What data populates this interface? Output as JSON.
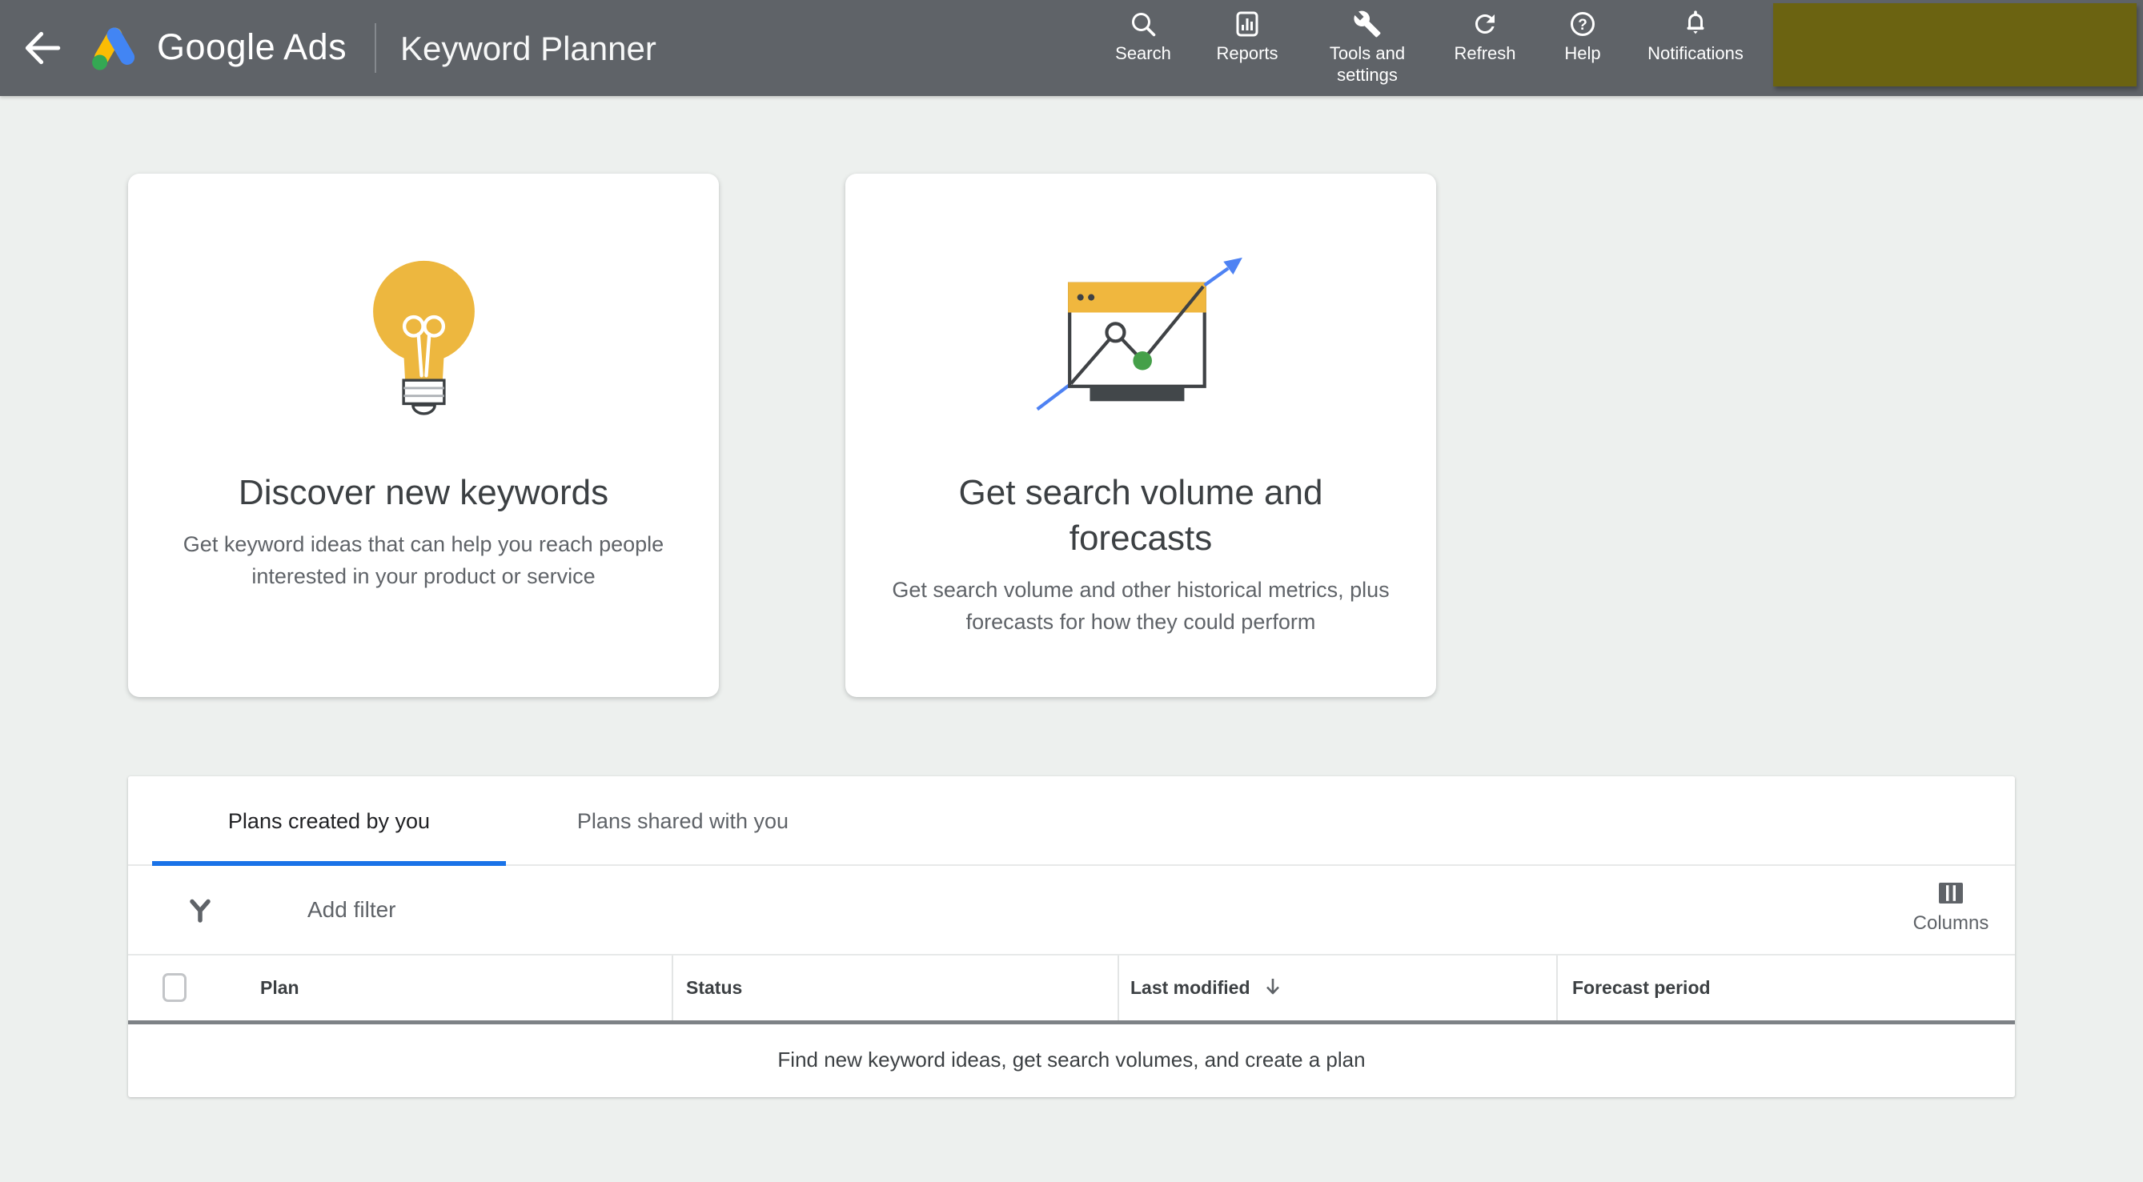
{
  "topbar": {
    "brand": {
      "word1": "Google",
      "word2": "Ads"
    },
    "page_title": "Keyword Planner",
    "nav": [
      {
        "icon": "search-icon",
        "label": "Search"
      },
      {
        "icon": "reports-icon",
        "label": "Reports"
      },
      {
        "icon": "wrench-icon",
        "label": "Tools and settings"
      },
      {
        "icon": "refresh-icon",
        "label": "Refresh"
      },
      {
        "icon": "help-icon",
        "label": "Help"
      },
      {
        "icon": "bell-icon",
        "label": "Notifications"
      }
    ],
    "help_glyph": "?"
  },
  "cards": [
    {
      "icon": "lightbulb-icon",
      "title": "Discover new keywords",
      "subtitle": "Get keyword ideas that can help you reach people interested in your product or service"
    },
    {
      "icon": "chart-window-icon",
      "title": "Get search volume and forecasts",
      "subtitle": "Get search volume and other historical metrics, plus forecasts for how they could perform"
    }
  ],
  "plans_panel": {
    "tabs": [
      {
        "label": "Plans created by you",
        "active": true
      },
      {
        "label": "Plans shared with you",
        "active": false
      }
    ],
    "filter_label": "Add filter",
    "columns_label": "Columns",
    "table": {
      "headers": [
        "Plan",
        "Status",
        "Last modified",
        "Forecast period"
      ],
      "sorted_by": "Last modified",
      "sort_direction": "descending",
      "rows": [],
      "empty_message": "Find new keyword ideas, get search volumes, and create a plan"
    }
  },
  "colors": {
    "topbar": "#5F6368",
    "background": "#EDF0EE",
    "accent_blue": "#1A73E8",
    "redaction_block": "#6B6311",
    "bulb_yellow": "#EDB73F",
    "window_yellow": "#F0B73E",
    "chart_green": "#45A049",
    "arrow_blue": "#4E82F3",
    "icon_dark": "#3F4245",
    "logo_blue": "#4285F4",
    "logo_yellow": "#FBBC04",
    "logo_green": "#34A853"
  }
}
